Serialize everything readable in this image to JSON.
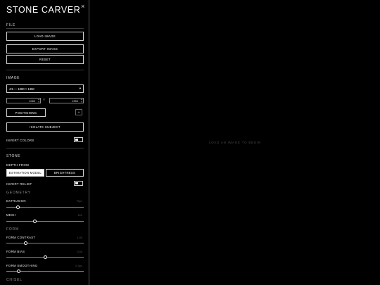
{
  "app": {
    "title": "STONE CARVER",
    "close_glyph": "×"
  },
  "file": {
    "heading": "FILE",
    "load_label": "LOAD IMAGE",
    "export_label": "EXPORT IMAGE",
    "reset_label": "RESET"
  },
  "image": {
    "heading": "IMAGE",
    "aspect_selected": "4:5 — 1080 × 1350",
    "width": "1080",
    "height": "1350",
    "times": "×",
    "positioning_label": "POSITIONING",
    "isolate_label": "ISOLATE SUBJECT",
    "invert_colors_label": "INVERT COLORS",
    "invert_colors_on": true
  },
  "stone": {
    "heading": "STONE",
    "depth_from_label": "DEPTH FROM",
    "depth_options": [
      "ESTIMATION MODEL",
      "BRIGHTNESS"
    ],
    "depth_selected": 0,
    "invert_relief_label": "INVERT RELIEF",
    "invert_relief_on": true,
    "geometry": {
      "heading": "GEOMETRY",
      "extrusion": {
        "label": "EXTRUSION",
        "value": "75px",
        "fraction": 0.15
      },
      "mesh": {
        "label": "MESH",
        "value": "161",
        "fraction": 0.37
      }
    },
    "form": {
      "heading": "FORM",
      "contrast": {
        "label": "FORM CONTRAST",
        "value": "1.00",
        "fraction": 0.25
      },
      "bias": {
        "label": "FORM BIAS",
        "value": "0.50",
        "fraction": 0.5
      },
      "smoothing": {
        "label": "FORM SMOOTHING",
        "value": "0.3px",
        "fraction": 0.16
      }
    },
    "chisel": {
      "heading": "CHISEL"
    }
  },
  "canvas": {
    "hint": "LOAD AN IMAGE TO BEGIN"
  },
  "colors": {
    "background": "#000000",
    "foreground": "#ffffff",
    "border": "#cfcfcf",
    "muted": "#8a8a8a"
  },
  "icons": {
    "close": "close-icon",
    "positioning_toggle": "crosshair-icon",
    "select_caret": "chevron-down-icon"
  }
}
